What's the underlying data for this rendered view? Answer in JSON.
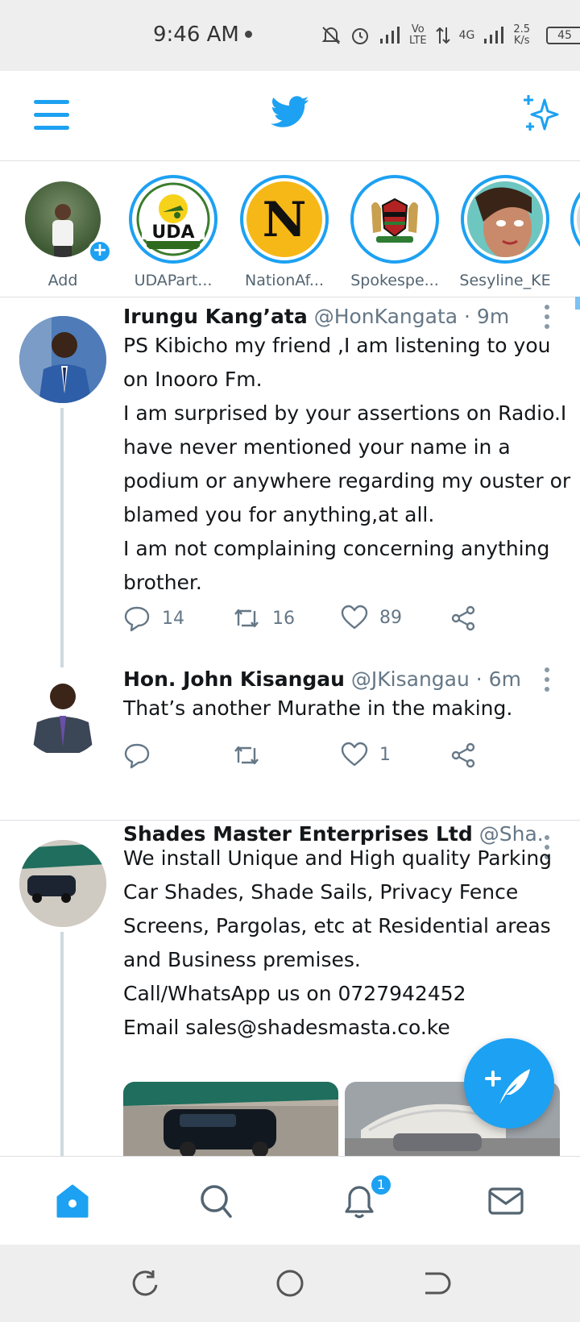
{
  "status_bar": {
    "time": "9:46 AM",
    "net_top": "Vo",
    "net_bottom": "LTE",
    "net_type": "4G",
    "speed_value": "2.5",
    "speed_unit": "K/s",
    "battery": "45"
  },
  "header": {
    "menu_icon": "hamburger-icon",
    "logo_icon": "twitter-bird-icon",
    "sparkle_icon": "sparkle-icon"
  },
  "fleets": [
    {
      "label": "Add"
    },
    {
      "label": "UDAPart...",
      "logo_text": "UDA"
    },
    {
      "label": "NationAf...",
      "logo_text": "N"
    },
    {
      "label": "Spokespe..."
    },
    {
      "label": "Sesyline_KE"
    }
  ],
  "tweets": [
    {
      "name": "Irungu Kang’ata",
      "handle": "@HonKangata",
      "time": "· 9m",
      "lines": [
        "PS Kibicho my friend ,I am listening to you",
        "on Inooro Fm.",
        "I am surprised by your assertions on Radio.I",
        "have never mentioned your name in a",
        "podium or anywhere regarding my ouster or",
        "blamed you for anything,at all.",
        "I am not complaining concerning anything",
        "brother."
      ],
      "replies": "14",
      "retweets": "16",
      "likes": "89"
    },
    {
      "name": "Hon. John Kisangau",
      "handle": "@JKisangau",
      "time": "· 6m",
      "lines": [
        "That’s another Murathe in the making."
      ],
      "replies": "",
      "retweets": "",
      "likes": "1"
    },
    {
      "name": "Shades Master Enterprises Ltd",
      "handle": "@Sha...",
      "lines": [
        "We install Unique and High quality Parking",
        "Car Shades, Shade Sails, Privacy Fence",
        "Screens, Pargolas, etc at Residential areas",
        "and Business premises.",
        "Call/WhatsApp us on 0727942452",
        "Email sales@shadesmasta.co.ke"
      ]
    }
  ],
  "bottom_nav": {
    "notifications_badge": "1",
    "items": [
      "home-icon",
      "search-icon",
      "bell-icon",
      "mail-icon"
    ]
  },
  "colors": {
    "accent": "#1da1f2",
    "text": "#14171a",
    "secondary": "#657786",
    "divider": "#dcdfe3"
  }
}
